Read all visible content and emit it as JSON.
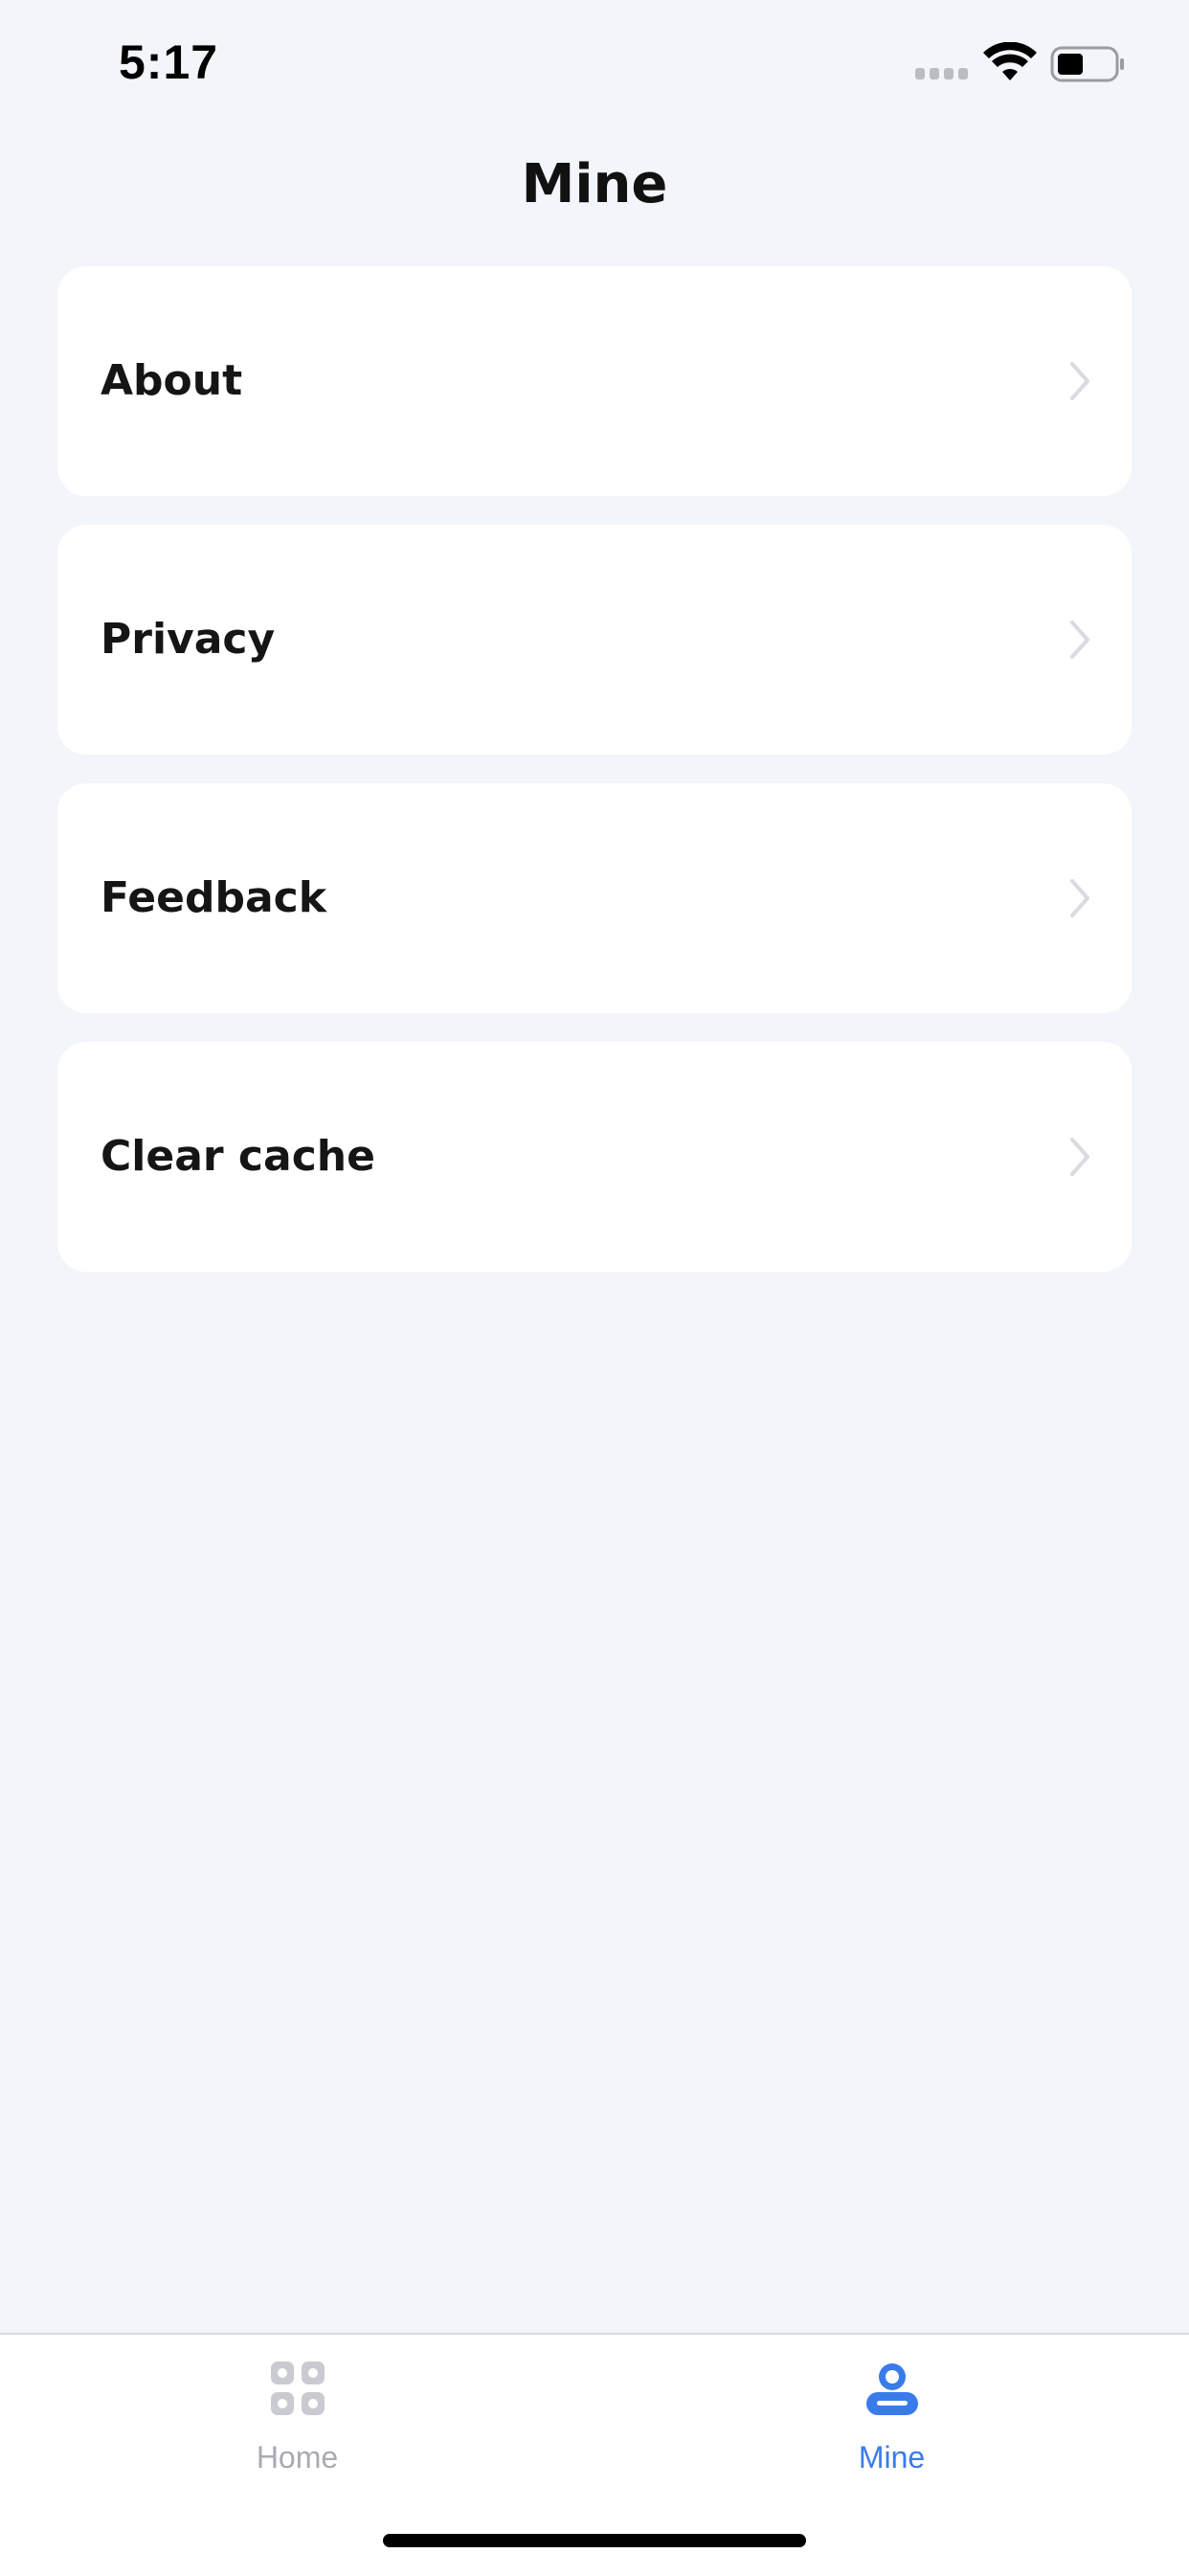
{
  "status_bar": {
    "time": "5:17"
  },
  "page": {
    "title": "Mine"
  },
  "menu": {
    "items": [
      {
        "label": "About",
        "icon": "chevron-right-icon"
      },
      {
        "label": "Privacy",
        "icon": "chevron-right-icon"
      },
      {
        "label": "Feedback",
        "icon": "chevron-right-icon"
      },
      {
        "label": "Clear cache",
        "icon": "chevron-right-icon"
      }
    ]
  },
  "tab_bar": {
    "tabs": [
      {
        "label": "Home",
        "icon": "grid-icon",
        "active": false
      },
      {
        "label": "Mine",
        "icon": "person-icon",
        "active": true
      }
    ]
  },
  "colors": {
    "background": "#f2f5fa",
    "card": "#ffffff",
    "accent": "#3a7bea",
    "inactive": "#a8abb1"
  }
}
